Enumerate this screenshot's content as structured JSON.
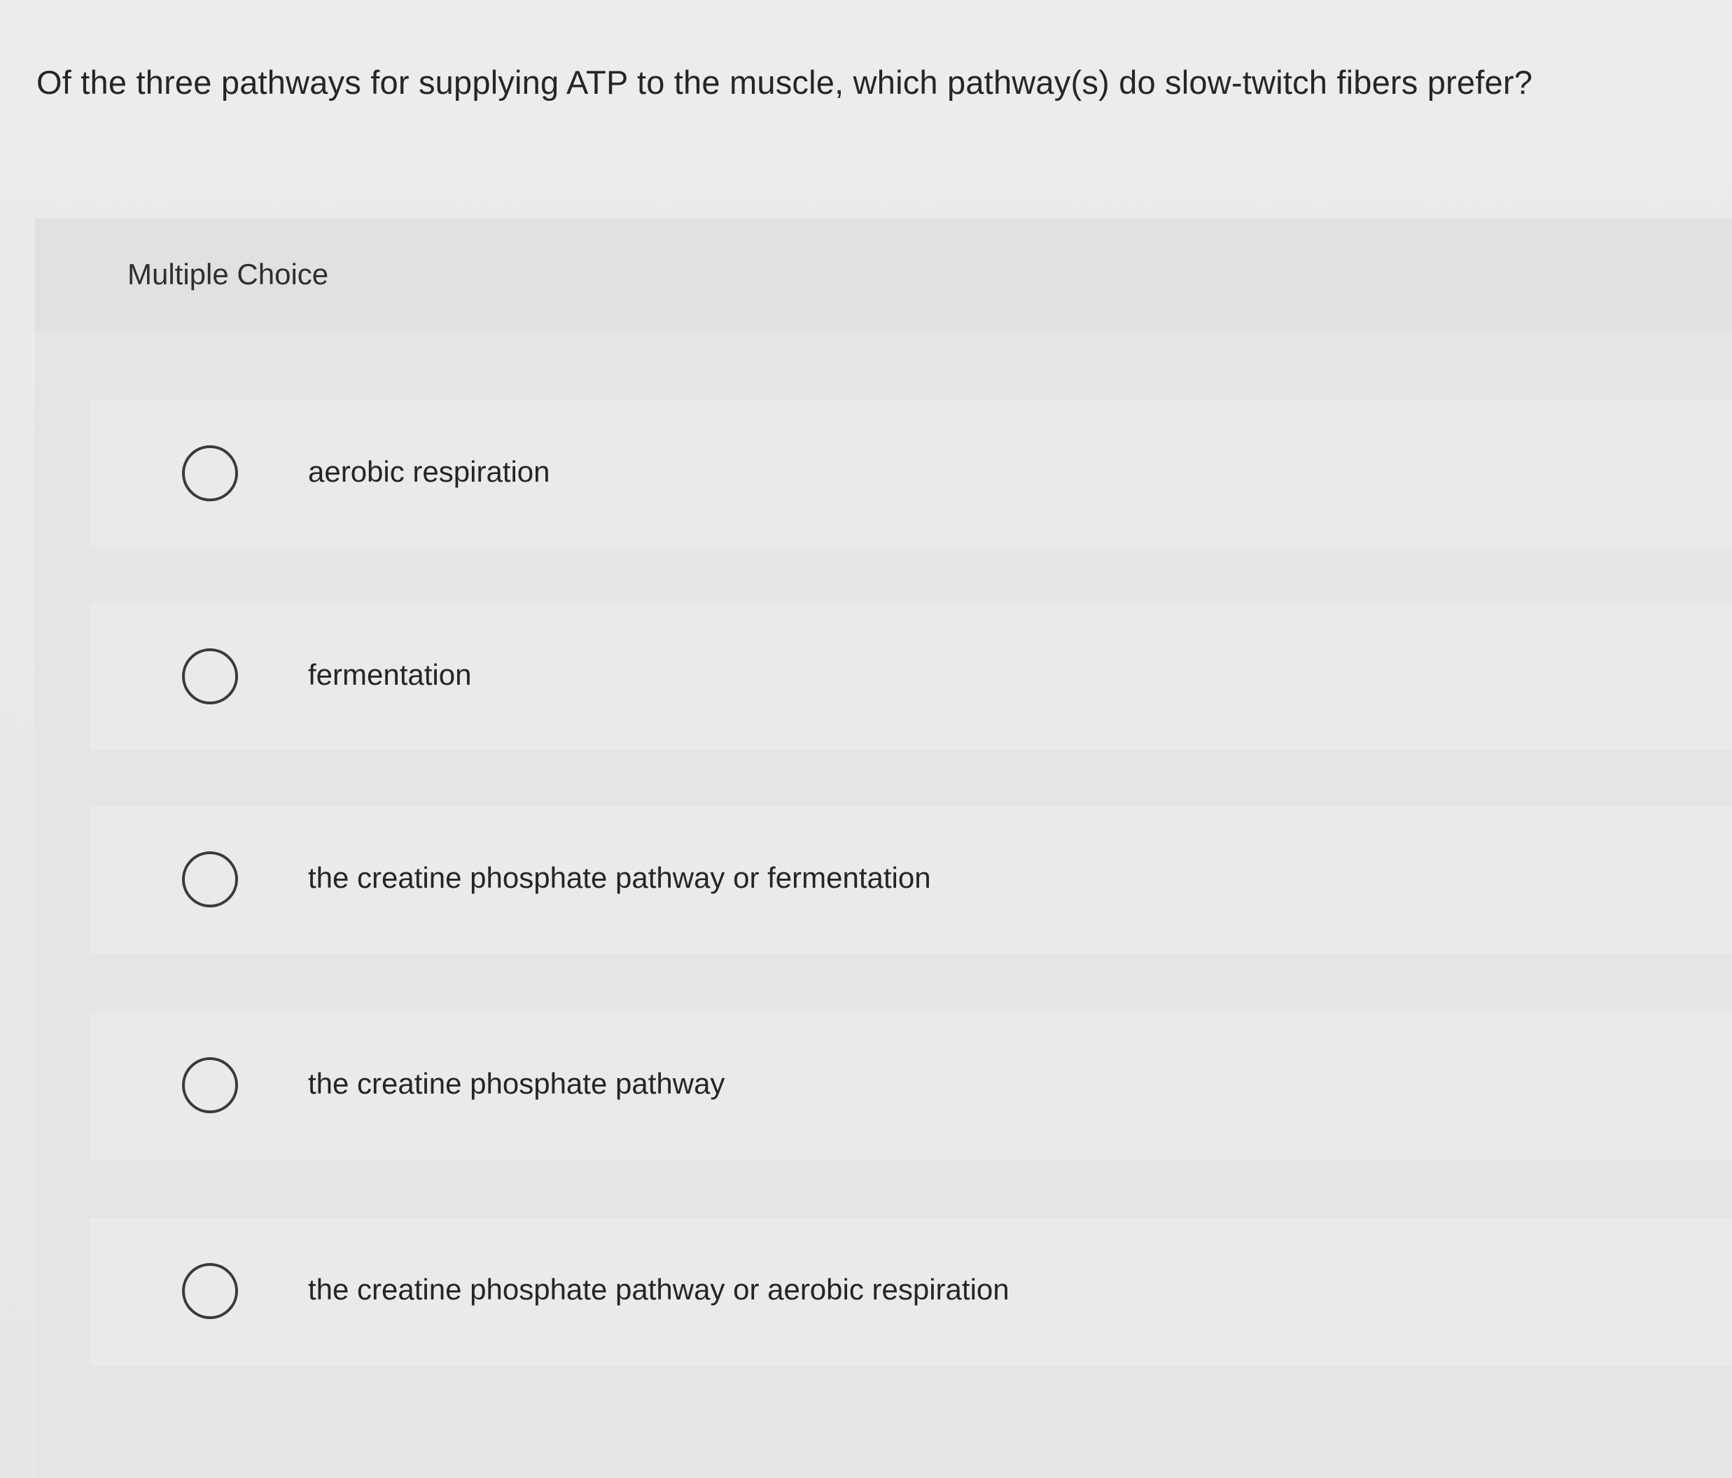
{
  "question": {
    "text": "Of the three pathways for supplying ATP to the muscle, which pathway(s) do slow-twitch fibers prefer?"
  },
  "panel": {
    "title": "Multiple Choice"
  },
  "options": [
    {
      "label": "aerobic respiration",
      "icon": "radio-empty-icon"
    },
    {
      "label": "fermentation",
      "icon": "radio-empty-icon"
    },
    {
      "label": "the creatine phosphate pathway or fermentation",
      "icon": "radio-empty-icon"
    },
    {
      "label": "the creatine phosphate pathway",
      "icon": "radio-empty-icon"
    },
    {
      "label": "the creatine phosphate pathway or aerobic respiration",
      "icon": "radio-empty-icon"
    }
  ],
  "colors": {
    "background": "#e8e9e9",
    "text": "#262626",
    "radio_border": "#3a3a3a"
  }
}
